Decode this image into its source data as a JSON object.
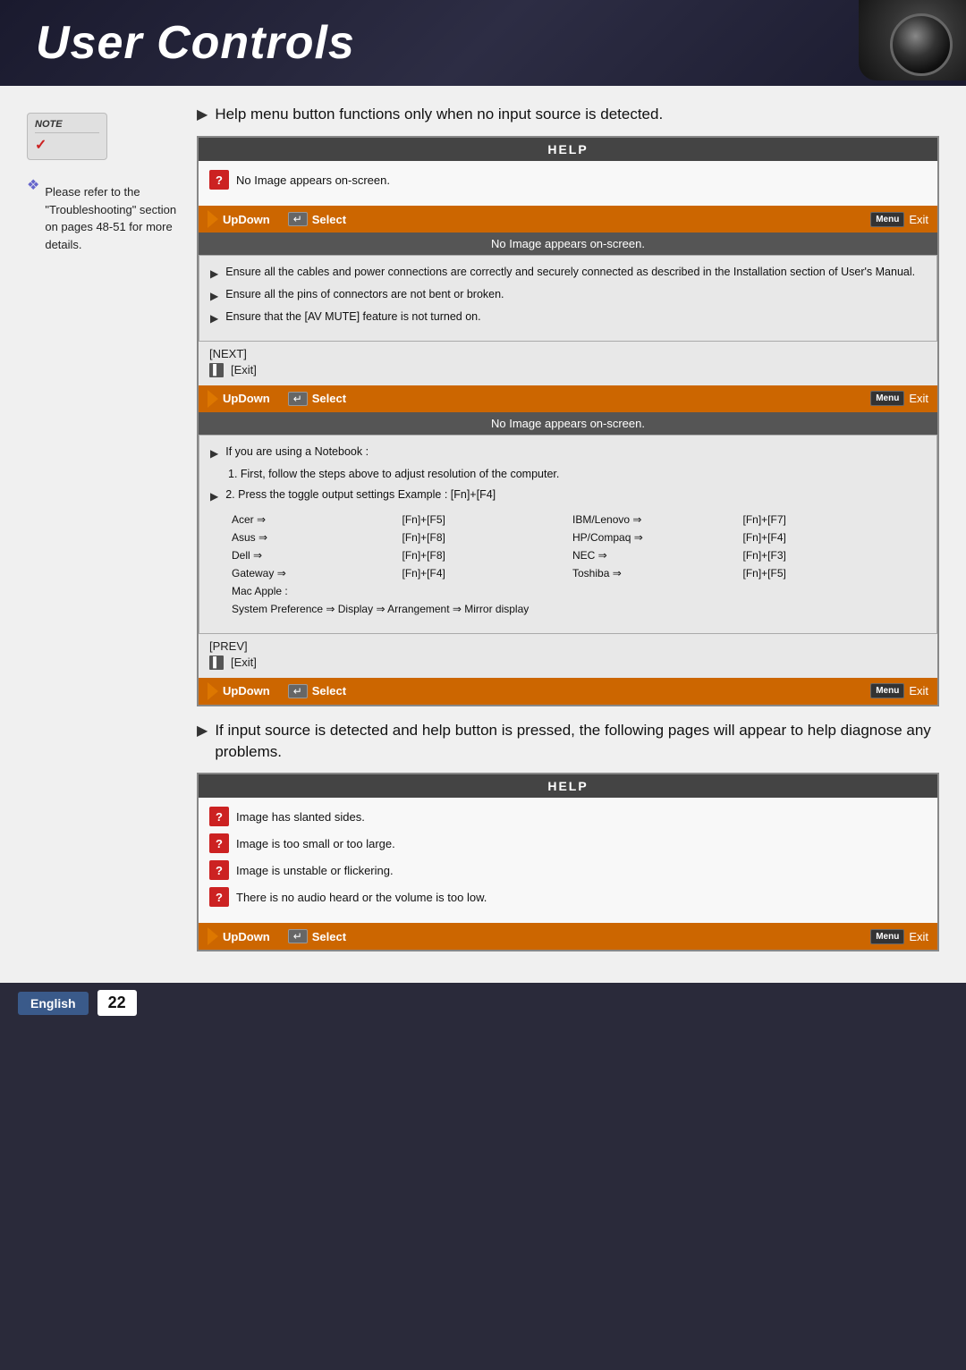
{
  "header": {
    "title": "User Controls"
  },
  "sidebar": {
    "note_label": "NOTE",
    "note_text": "Please refer to the \"Troubleshooting\" section on pages 48-51 for more details.",
    "dot": "❖"
  },
  "section1": {
    "bullet_text": "Help menu button functions only when no input source is detected."
  },
  "help_panel_1": {
    "title": "HELP",
    "question": "No Image appears on-screen."
  },
  "nav_bar_1": {
    "updown": "UpDown",
    "select": "Select",
    "menu": "Menu",
    "exit": "Exit"
  },
  "section_title_1": "No Image appears on-screen.",
  "inner_bullets_1": [
    "Ensure all the cables and power connections are correctly and securely connected as described in the Installation section of User's Manual.",
    "Ensure all the pins of connectors are not bent or broken.",
    "Ensure that the [AV MUTE] feature is not turned on."
  ],
  "nav_items_1": [
    "[NEXT]",
    "[Exit]"
  ],
  "nav_bar_2": {
    "updown": "UpDown",
    "select": "Select",
    "menu": "Menu",
    "exit": "Exit"
  },
  "section_title_2": "No Image appears on-screen.",
  "inner_bullets_2": {
    "heading": "If you are using a Notebook :",
    "items": [
      "1. First, follow the steps above to adjust resolution of the computer.",
      "2. Press the toggle output settings  Example : [Fn]+[F4]"
    ]
  },
  "laptop_table": {
    "rows": [
      {
        "brand": "Acer",
        "key": "[Fn]+[F5]",
        "brand2": "IBM/Lenovo",
        "key2": "[Fn]+[F7]"
      },
      {
        "brand": "Asus",
        "key": "[Fn]+[F8]",
        "brand2": "HP/Compaq",
        "key2": "[Fn]+[F4]"
      },
      {
        "brand": "Dell",
        "key": "[Fn]+[F8]",
        "brand2": "NEC",
        "key2": "[Fn]+[F3]"
      },
      {
        "brand": "Gateway",
        "key": "[Fn]+[F4]",
        "brand2": "Toshiba",
        "key2": "[Fn]+[F5]"
      }
    ],
    "mac_row": "Mac Apple :",
    "mac_pref": "System Preference ⇒ Display ⇒ Arrangement ⇒ Mirror display"
  },
  "nav_items_2": [
    "[PREV]",
    "[Exit]"
  ],
  "nav_bar_3": {
    "updown": "UpDown",
    "select": "Select",
    "menu": "Menu",
    "exit": "Exit"
  },
  "section2": {
    "bullet_text": "If input source is detected and help button is pressed, the following pages will appear to help diagnose any problems."
  },
  "help_panel_2": {
    "title": "HELP",
    "questions": [
      "Image has slanted sides.",
      "Image is too small or too large.",
      "Image is unstable or flickering.",
      "There is no audio heard or the volume is too low."
    ]
  },
  "nav_bar_4": {
    "updown": "UpDown",
    "select": "Select",
    "menu": "Menu",
    "exit": "Exit"
  },
  "footer": {
    "language": "English",
    "page_number": "22"
  }
}
